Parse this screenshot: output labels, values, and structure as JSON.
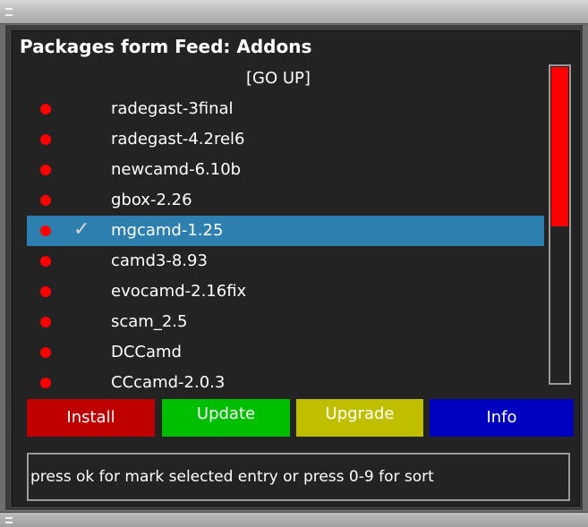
{
  "window": {
    "grip_icon": "window-grip-icon"
  },
  "header": {
    "title": "Packages form Feed: Addons"
  },
  "list": {
    "go_up": "[GO UP]",
    "items": [
      {
        "label": "radegast-3final",
        "status": "not-installed",
        "checked": false
      },
      {
        "label": "radegast-4.2rel6",
        "status": "not-installed",
        "checked": false
      },
      {
        "label": "newcamd-6.10b",
        "status": "not-installed",
        "checked": false
      },
      {
        "label": "gbox-2.26",
        "status": "not-installed",
        "checked": false
      },
      {
        "label": "mgcamd-1.25",
        "status": "not-installed",
        "checked": true,
        "selected": true,
        "check_glyph": "✓"
      },
      {
        "label": "camd3-8.93",
        "status": "not-installed",
        "checked": false
      },
      {
        "label": "evocamd-2.16fix",
        "status": "not-installed",
        "checked": false
      },
      {
        "label": "scam_2.5",
        "status": "not-installed",
        "checked": false
      },
      {
        "label": "DCCamd",
        "status": "not-installed",
        "checked": false
      },
      {
        "label": "CCcamd-2.0.3",
        "status": "not-installed",
        "checked": false
      }
    ]
  },
  "scrollbar": {
    "position_fraction": 0.0,
    "visible_fraction": 0.5
  },
  "buttons": {
    "red": "Install",
    "green": "Update",
    "yellow": "Upgrade",
    "blue": "Info"
  },
  "status": {
    "text": "press ok for mark selected entry or press 0-9 for sort"
  },
  "colors": {
    "background": "#232323",
    "selection": "#2d7fb0",
    "status_dot": "#ff0000",
    "scroll_thumb": "#ff0000",
    "red_button": "#bf0000",
    "green_button": "#00bf00",
    "yellow_button": "#bfbf00",
    "blue_button": "#0000bf"
  }
}
